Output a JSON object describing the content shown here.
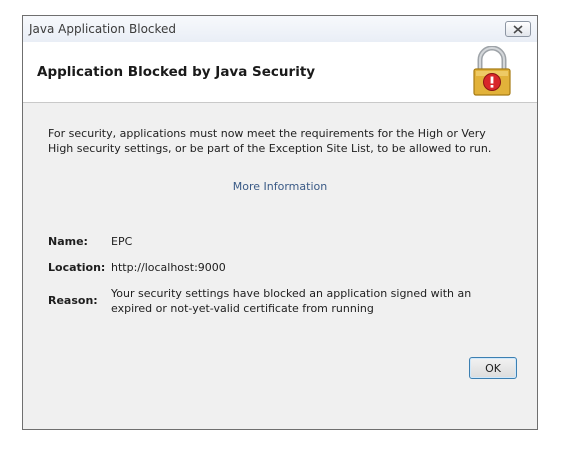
{
  "window": {
    "title": "Java Application Blocked"
  },
  "header": {
    "title": "Application Blocked by Java Security"
  },
  "message": "For security, applications must now meet the requirements for the High or Very High security settings, or be part of the Exception Site List, to be allowed to run.",
  "more_info_link": "More Information",
  "details": {
    "name_label": "Name:",
    "name_value": "EPC",
    "location_label": "Location:",
    "location_value": "http://localhost:9000",
    "reason_label": "Reason:",
    "reason_value": "Your security settings have blocked an application signed with an expired or not-yet-valid certificate from running"
  },
  "buttons": {
    "ok": "OK"
  },
  "icons": {
    "close": "close-icon",
    "lock": "padlock-warning-icon"
  },
  "colors": {
    "link": "#3a5a86",
    "lock_gold": "#e2b23a",
    "warning_red": "#d8262a"
  }
}
